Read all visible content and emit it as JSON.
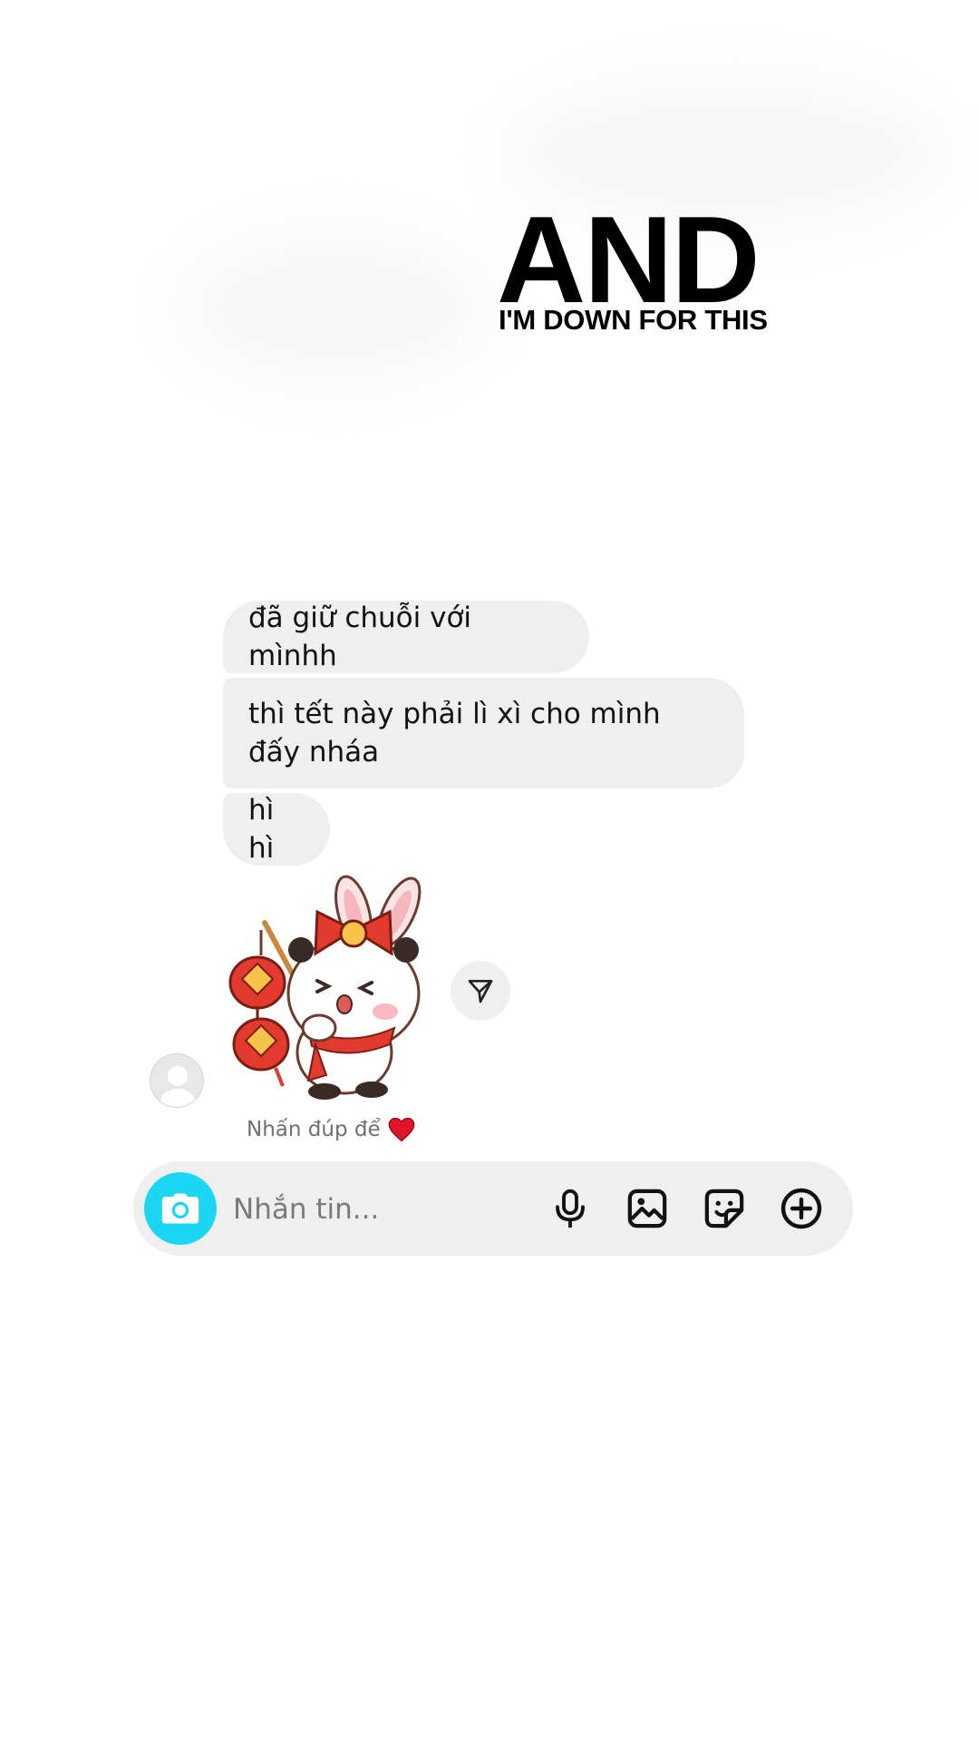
{
  "overlay": {
    "title": "AND",
    "subtitle": "I'M DOWN FOR THIS"
  },
  "messages": [
    {
      "text": "đã giữ chuỗi với mìnhh"
    },
    {
      "text": "thì tết này phải lì xì cho mình đấy nháa"
    },
    {
      "text": "hì hì"
    }
  ],
  "sticker": {
    "icon": "panda-lantern-sticker"
  },
  "hint": {
    "text": "Nhấn đúp để",
    "icon": "red-heart-icon"
  },
  "composer": {
    "placeholder": "Nhắn tin...",
    "accent_color": "#1ad6f2",
    "icons": [
      "camera-icon",
      "microphone-icon",
      "image-icon",
      "sticker-icon",
      "plus-circle-icon"
    ]
  }
}
